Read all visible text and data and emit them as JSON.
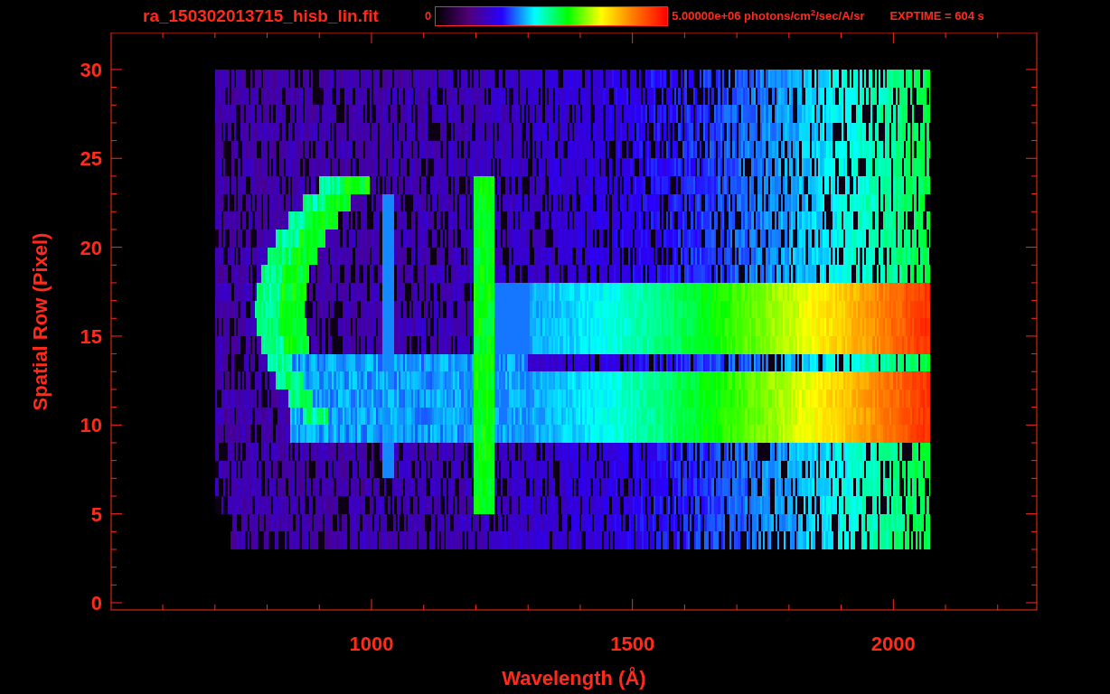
{
  "title": "ra_150302013715_hisb_lin.fit",
  "colorbar": {
    "min": "0",
    "max": "5.00000e+06 photons/cm$^{2}$/sec/A/sr"
  },
  "exposure": "EXPTIME = 604 s",
  "y_axis": {
    "label": "Spatial Row (Pixel)",
    "ticks": [
      "30",
      "25",
      "20",
      "15",
      "10",
      "5",
      "0"
    ]
  },
  "x_axis": {
    "label": "Wavelength (Å)",
    "ticks": [
      "1000",
      "1500",
      "2000"
    ]
  }
}
